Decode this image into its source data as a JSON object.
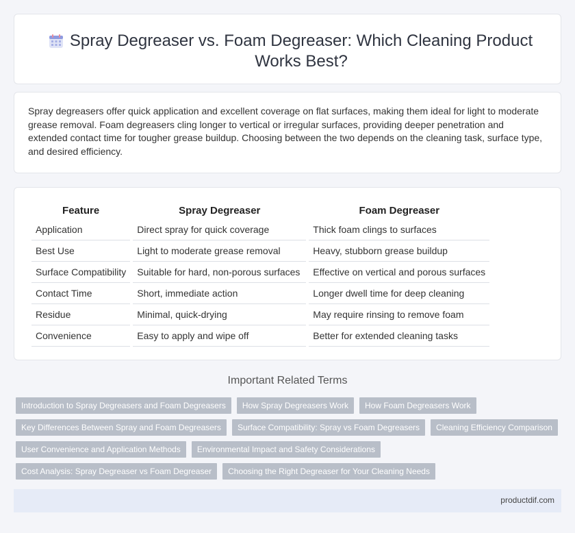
{
  "header": {
    "title": "Spray Degreaser vs. Foam Degreaser: Which Cleaning Product Works Best?",
    "icon": "calendar-icon"
  },
  "intro": {
    "text": "Spray degreasers offer quick application and excellent coverage on flat surfaces, making them ideal for light to moderate grease removal. Foam degreasers cling longer to vertical or irregular surfaces, providing deeper penetration and extended contact time for tougher grease buildup. Choosing between the two depends on the cleaning task, surface type, and desired efficiency."
  },
  "table": {
    "headers": [
      "Feature",
      "Spray Degreaser",
      "Foam Degreaser"
    ],
    "rows": [
      [
        "Application",
        "Direct spray for quick coverage",
        "Thick foam clings to surfaces"
      ],
      [
        "Best Use",
        "Light to moderate grease removal",
        "Heavy, stubborn grease buildup"
      ],
      [
        "Surface Compatibility",
        "Suitable for hard, non-porous surfaces",
        "Effective on vertical and porous surfaces"
      ],
      [
        "Contact Time",
        "Short, immediate action",
        "Longer dwell time for deep cleaning"
      ],
      [
        "Residue",
        "Minimal, quick-drying",
        "May require rinsing to remove foam"
      ],
      [
        "Convenience",
        "Easy to apply and wipe off",
        "Better for extended cleaning tasks"
      ]
    ]
  },
  "related": {
    "title": "Important Related Terms",
    "tags": [
      [
        "Introduction to Spray Degreasers and Foam Degreasers",
        "How Spray Degreasers Work",
        "How Foam Degreasers Work"
      ],
      [
        "Key Differences Between Spray and Foam Degreasers",
        "Surface Compatibility: Spray vs Foam Degreasers",
        "Cleaning Efficiency Comparison"
      ],
      [
        "User Convenience and Application Methods",
        "Environmental Impact and Safety Considerations"
      ],
      [
        "Cost Analysis: Spray Degreaser vs Foam Degreaser",
        "Choosing the Right Degreaser for Your Cleaning Needs"
      ]
    ]
  },
  "footer": {
    "site": "productdif.com"
  },
  "colors": {
    "tag_bg": "#b8bec8",
    "footer_bg": "#e6ebf7",
    "page_bg": "#f4f5f9"
  }
}
